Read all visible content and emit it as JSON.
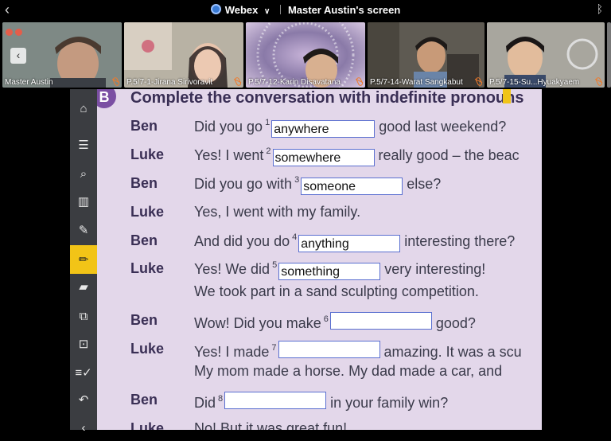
{
  "topbar": {
    "app_name": "Webex",
    "separator_chevron": "∨",
    "screen_title": "Master Austin's screen",
    "back_icon": "chevron-left-icon",
    "bluetooth_icon": "bluetooth-icon"
  },
  "participants": [
    {
      "name": "Master Austin",
      "bg": "#6b7774"
    },
    {
      "name": "P.5/7-1-Jirana Sirivoravit",
      "bg": "#a8a090"
    },
    {
      "name": "P.5/7-12-Karin Disavatana",
      "bg": "#8a7a9a"
    },
    {
      "name": "P.5/7-14-Warat Sangkabut",
      "bg": "#6a665e"
    },
    {
      "name": "P.5/7-15-Su...Hyuakyaem",
      "bg": "#9a988e"
    }
  ],
  "sidebar": {
    "tools": [
      "home-icon",
      "table-of-contents-icon",
      "search-icon",
      "bookshelf-icon",
      "pen-icon",
      "highlighter-icon",
      "sticky-note-icon",
      "copy-icon",
      "screenshot-icon",
      "checklist-icon",
      "undo-icon",
      "chevron-left-icon"
    ],
    "glyphs": [
      "⌂",
      "☰",
      "⌕",
      "▥",
      "✎",
      "✏",
      "▰",
      "⧉",
      "⊡",
      "≡✓",
      "↶",
      "‹"
    ],
    "expand_label": "›"
  },
  "exercise": {
    "badge": "B",
    "heading": "Complete the conversation with indefinite pronouns",
    "lines": [
      {
        "speaker": "Ben",
        "pre": "Did you go",
        "num": "1",
        "answer": "anywhere",
        "post": "good last weekend?"
      },
      {
        "speaker": "Luke",
        "pre": "Yes! I went",
        "num": "2",
        "answer": "somewhere",
        "post": "really good – the beac"
      },
      {
        "speaker": "Ben",
        "pre": "Did you go with",
        "num": "3",
        "answer": "someone",
        "post": "else?"
      },
      {
        "speaker": "Luke",
        "pre": "Yes, I went with my family.",
        "num": "",
        "answer": "",
        "post": ""
      },
      {
        "speaker": "Ben",
        "pre": "And did you do",
        "num": "4",
        "answer": "anything",
        "post": "interesting there?"
      },
      {
        "speaker": "Luke",
        "pre": "Yes! We did",
        "num": "5",
        "answer": "something",
        "post": "very interesting!"
      },
      {
        "speaker": "",
        "pre": "We took part in a sand sculpting competition.",
        "num": "",
        "answer": "",
        "post": ""
      },
      {
        "speaker": "Ben",
        "pre": "Wow! Did you make",
        "num": "6",
        "answer": "",
        "post": "good?"
      },
      {
        "speaker": "Luke",
        "pre": "Yes! I made",
        "num": "7",
        "answer": "",
        "post": "amazing. It was a scu"
      },
      {
        "speaker": "",
        "pre": "My mom made a horse. My dad made a car, and",
        "num": "",
        "answer": "",
        "post": ""
      },
      {
        "speaker": "Ben",
        "pre": "Did",
        "num": "8",
        "answer": "",
        "post": "in your family win?"
      },
      {
        "speaker": "Luke",
        "pre": "No! But it was great fun!",
        "num": "",
        "answer": "",
        "post": ""
      }
    ]
  }
}
